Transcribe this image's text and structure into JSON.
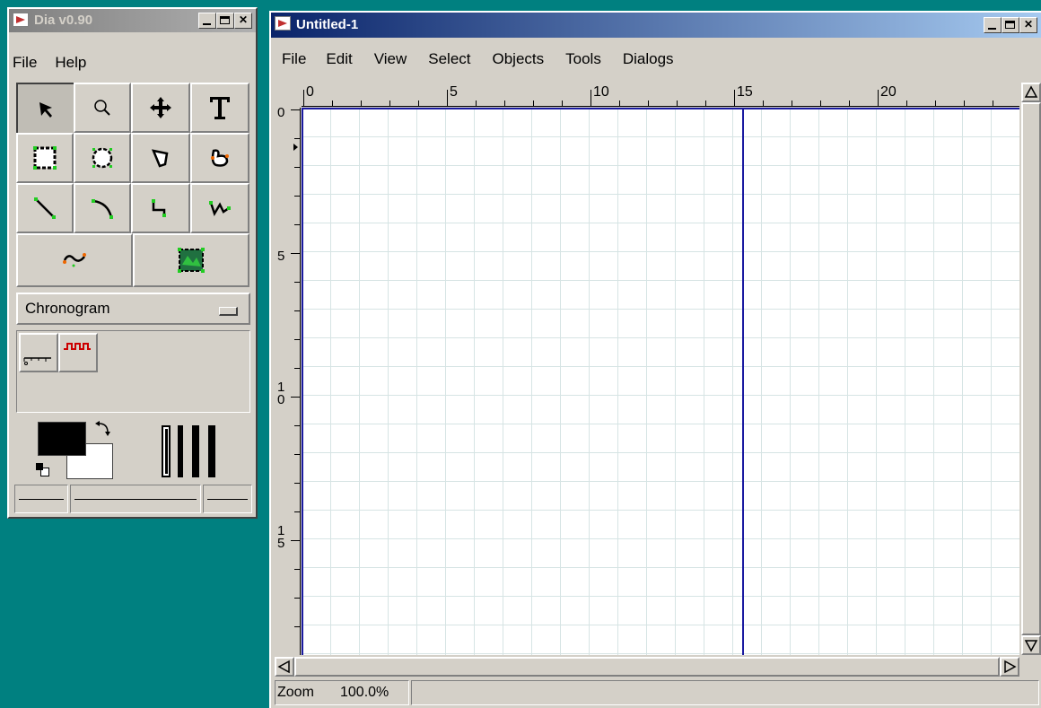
{
  "toolbox": {
    "title": "Dia v0.90",
    "menu": [
      "File",
      "Help"
    ],
    "sheet_selector": "Chronogram",
    "tools": [
      "pointer",
      "magnify",
      "scroll",
      "text",
      "box",
      "ellipse",
      "polygon",
      "beziergon",
      "line",
      "arc",
      "zigzagline",
      "polyline",
      "bezierline",
      "image"
    ],
    "sheet_items": [
      "chronogram-reference",
      "chronogram-line"
    ]
  },
  "diagram": {
    "title": "Untitled-1",
    "menu": [
      "File",
      "Edit",
      "View",
      "Select",
      "Objects",
      "Tools",
      "Dialogs"
    ],
    "hruler_labels": [
      "0",
      "5",
      "10",
      "15",
      "20"
    ],
    "vruler_labels": [
      "0",
      "5",
      "1\n0",
      "1\n5"
    ],
    "zoom_label": "Zoom",
    "zoom_value": "100.0%"
  },
  "colors": {
    "desktop": "#008080",
    "page_boundary": "#1a1aa0",
    "grid": "#d6e4e4"
  }
}
